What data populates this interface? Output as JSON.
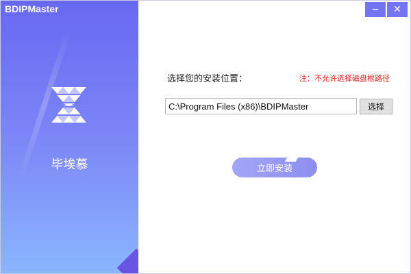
{
  "window": {
    "title": "BDIPMaster",
    "minimize_label": "−",
    "close_label": "✕"
  },
  "sidebar": {
    "brand_name": "毕埃慕",
    "logo_icon": "triangle-hourglass-logo",
    "gradient_top": "#6868f2",
    "gradient_bottom": "#8ab6ff"
  },
  "main": {
    "location_label": "选择您的安装位置：",
    "warning_text": "注：不允许选择磁盘根路径",
    "path_value": "C:\\Program Files (x86)\\BDIPMaster",
    "browse_label": "选择",
    "install_label": "立即安装"
  },
  "colors": {
    "accent": "#7574f2",
    "warning": "#e02020",
    "button_bg": "#e1e1e1"
  }
}
